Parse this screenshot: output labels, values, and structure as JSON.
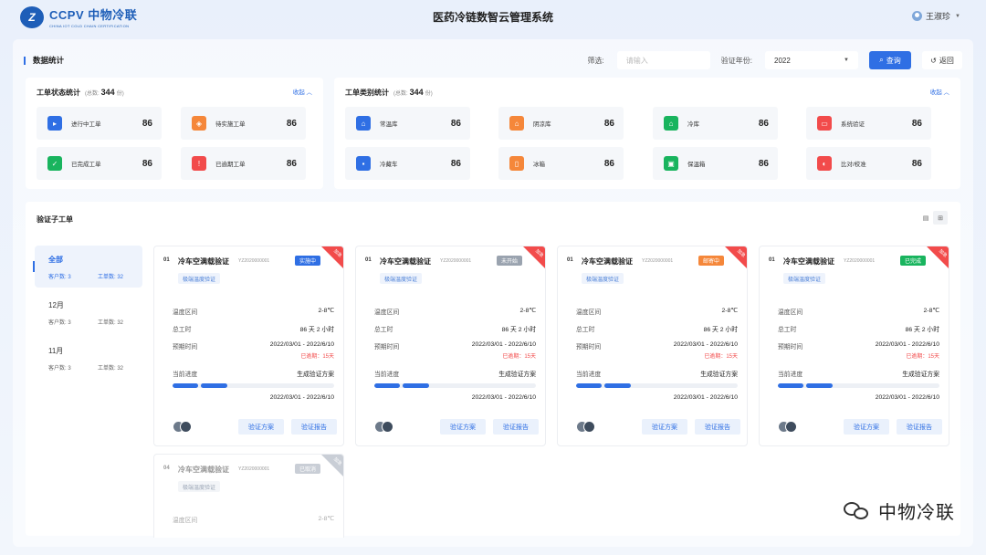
{
  "header": {
    "logo_mark": "Z",
    "logo_text": "CCPV 中物冷联",
    "logo_sub": "CHINA IOT COLD CHAIN CERTIFICATION",
    "title": "医药冷链数智云管理系统",
    "user": "王淑珍"
  },
  "filter_bar": {
    "title": "数据统计",
    "filter_label": "筛选:",
    "input_placeholder": "请输入",
    "year_label": "验证年份:",
    "year_value": "2022",
    "query_btn": "查询",
    "back_btn": "返回"
  },
  "work_status": {
    "title": "工单状态统计",
    "total_prefix": "(总数:",
    "total": "344",
    "total_suffix": "份)",
    "fold": "收起",
    "items": [
      {
        "label": "进行中工单",
        "value": "86",
        "color": "#2f6fe4",
        "icon": "play-icon",
        "glyph": "▸"
      },
      {
        "label": "待实施工单",
        "value": "86",
        "color": "#f5873a",
        "icon": "cube-icon",
        "glyph": "◈"
      },
      {
        "label": "已完成工单",
        "value": "86",
        "color": "#19b45e",
        "icon": "check-icon",
        "glyph": "✓"
      },
      {
        "label": "已逾期工单",
        "value": "86",
        "color": "#f24b4b",
        "icon": "alert-icon",
        "glyph": "!"
      }
    ]
  },
  "work_type": {
    "title": "工单类别统计",
    "total_prefix": "(总数:",
    "total": "344",
    "total_suffix": "份)",
    "fold": "收起",
    "items": [
      {
        "label": "常温库",
        "value": "86",
        "color": "#2f6fe4",
        "icon": "warehouse-icon",
        "glyph": "⌂"
      },
      {
        "label": "阴凉库",
        "value": "86",
        "color": "#f5873a",
        "icon": "warehouse-icon",
        "glyph": "⌂"
      },
      {
        "label": "冷库",
        "value": "86",
        "color": "#19b45e",
        "icon": "warehouse-icon",
        "glyph": "⌂"
      },
      {
        "label": "系统验证",
        "value": "86",
        "color": "#f24b4b",
        "icon": "monitor-icon",
        "glyph": "▭"
      },
      {
        "label": "冷藏车",
        "value": "86",
        "color": "#2f6fe4",
        "icon": "truck-icon",
        "glyph": "▪"
      },
      {
        "label": "冰箱",
        "value": "86",
        "color": "#f5873a",
        "icon": "fridge-icon",
        "glyph": "▯"
      },
      {
        "label": "保温箱",
        "value": "86",
        "color": "#19b45e",
        "icon": "box-icon",
        "glyph": "▣"
      },
      {
        "label": "比对/校准",
        "value": "86",
        "color": "#f24b4b",
        "icon": "calibrate-icon",
        "glyph": "◐"
      }
    ]
  },
  "sub_orders": {
    "title": "验证子工单",
    "sidebar": [
      {
        "name": "全部",
        "customers_label": "客户数:",
        "customers": "3",
        "orders_label": "工单数:",
        "orders": "32"
      },
      {
        "name": "12月",
        "customers_label": "客户数:",
        "customers": "3",
        "orders_label": "工单数:",
        "orders": "32"
      },
      {
        "name": "11月",
        "customers_label": "客户数:",
        "customers": "3",
        "orders_label": "工单数:",
        "orders": "32"
      }
    ],
    "labels": {
      "temp": "温度区间",
      "hours": "总工时",
      "planned": "预期时间",
      "progress": "当前进度",
      "scheme_btn": "验证方案",
      "report_btn": "验证报告"
    },
    "cards": [
      {
        "num": "01",
        "name": "冷车空满载验证",
        "code": "YZ2020000001",
        "status": "实施中",
        "status_color": "#2f6fe4",
        "ribbon": "加急",
        "ribbon_color": "#f24b4b",
        "tag": "极端温度验证",
        "temp": "2-8℃",
        "hours": "86 天 2 小时",
        "planned": "2022/03/01 - 2022/6/10",
        "overdue": "已逾期：15天",
        "progress": "生成验证方案",
        "dates": "2022/03/01 - 2022/6/10"
      },
      {
        "num": "01",
        "name": "冷车空满载验证",
        "code": "YZ2020000001",
        "status": "未开始",
        "status_color": "#9aa3af",
        "ribbon": "加急",
        "ribbon_color": "#f24b4b",
        "tag": "极端温度验证",
        "temp": "2-8℃",
        "hours": "86 天 2 小时",
        "planned": "2022/03/01 - 2022/6/10",
        "overdue": "已逾期：15天",
        "progress": "生成验证方案",
        "dates": "2022/03/01 - 2022/6/10"
      },
      {
        "num": "01",
        "name": "冷车空满载验证",
        "code": "YZ2020000001",
        "status": "邮寄中",
        "status_color": "#f5873a",
        "ribbon": "加急",
        "ribbon_color": "#f24b4b",
        "tag": "极端温度验证",
        "temp": "2-8℃",
        "hours": "86 天 2 小时",
        "planned": "2022/03/01 - 2022/6/10",
        "overdue": "已逾期：15天",
        "progress": "生成验证方案",
        "dates": "2022/03/01 - 2022/6/10"
      },
      {
        "num": "01",
        "name": "冷车空满载验证",
        "code": "YZ2020000001",
        "status": "已完成",
        "status_color": "#19b45e",
        "ribbon": "加急",
        "ribbon_color": "#f24b4b",
        "tag": "极端温度验证",
        "temp": "2-8℃",
        "hours": "86 天 2 小时",
        "planned": "2022/03/01 - 2022/6/10",
        "overdue": "已逾期：15天",
        "progress": "生成验证方案",
        "dates": "2022/03/01 - 2022/6/10"
      },
      {
        "num": "04",
        "name": "冷车空满载验证",
        "code": "YZ2020000001",
        "status": "已取消",
        "status_color": "#c9ced6",
        "ribbon": "加急",
        "ribbon_color": "#c9ced6",
        "tag": "极端温度验证",
        "temp": "2-8℃"
      }
    ]
  },
  "watermark": "中物冷联"
}
